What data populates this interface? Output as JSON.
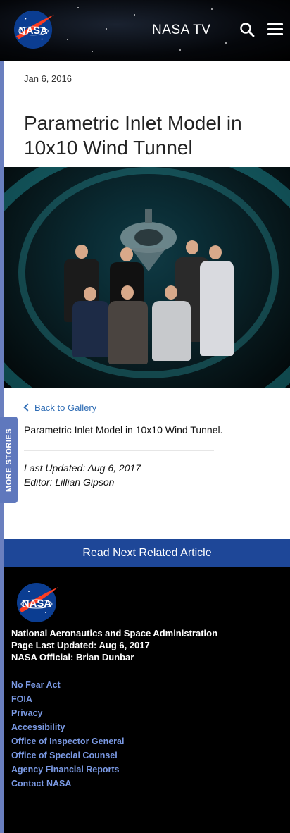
{
  "header": {
    "logo_text": "NASA",
    "tv_label": "NASA TV",
    "icons": [
      "nasa-logo",
      "search-icon",
      "menu-icon"
    ]
  },
  "article": {
    "date": "Jan 6, 2016",
    "title": "Parametric Inlet Model in 10x10 Wind Tunnel",
    "back_link": "Back to Gallery",
    "caption": "Parametric Inlet Model in 10x10 Wind Tunnel.",
    "last_updated": "Last Updated: Aug 6, 2017",
    "editor": "Editor: Lillian Gipson"
  },
  "more_stories": "MORE STORIES",
  "read_next": "Read Next Related Article",
  "footer": {
    "logo_text": "NASA",
    "agency": "National Aeronautics and Space Administration",
    "page_updated": "Page Last Updated: Aug 6, 2017",
    "official": "NASA Official: Brian Dunbar",
    "links": [
      "No Fear Act",
      "FOIA",
      "Privacy",
      "Accessibility",
      "Office of Inspector General",
      "Office of Special Counsel",
      "Agency Financial Reports",
      "Contact NASA"
    ]
  },
  "colors": {
    "accent": "#1e4798",
    "link": "#2f6db5",
    "footer_link": "#7a99e3",
    "side_tab": "#5f78bd"
  }
}
